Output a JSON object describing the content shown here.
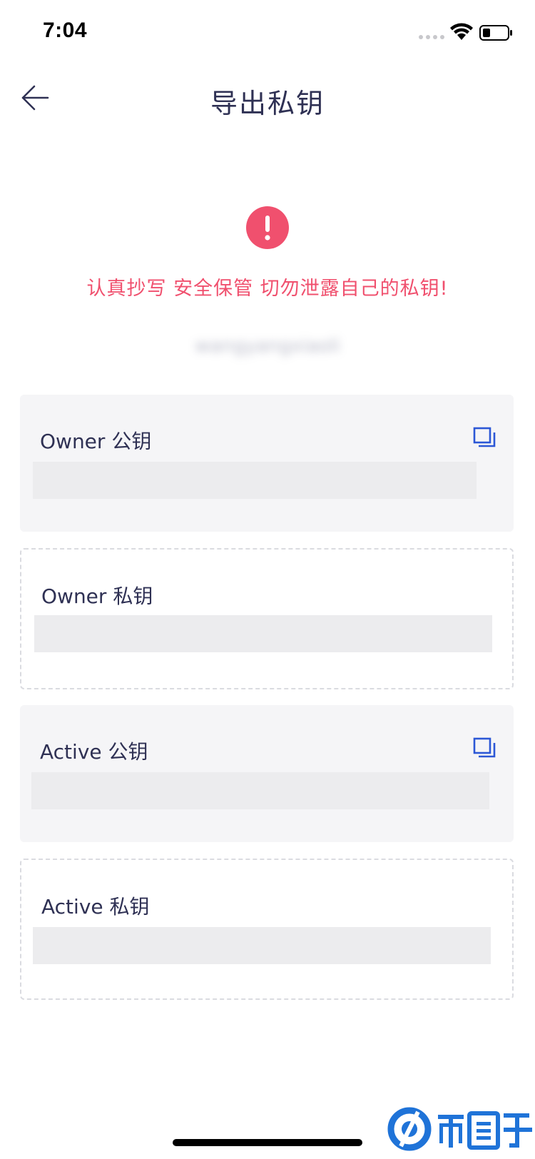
{
  "status_bar": {
    "time": "7:04"
  },
  "nav": {
    "title": "导出私钥"
  },
  "warning": {
    "text": "认真抄写 安全保管 切勿泄露自己的私钥!",
    "color": "#f0506e"
  },
  "account": {
    "name": "wangyangxiaoli"
  },
  "keys": [
    {
      "label": "Owner 公钥",
      "type": "public"
    },
    {
      "label": "Owner 私钥",
      "type": "private"
    },
    {
      "label": "Active 公钥",
      "type": "public"
    },
    {
      "label": "Active 私钥",
      "type": "private"
    }
  ],
  "colors": {
    "primary_text": "#2f3154",
    "accent_blue": "#2c57d6",
    "warning_red": "#f0506e",
    "card_bg": "#f5f5f7"
  },
  "icons": {
    "back": "arrow-left-icon",
    "warning": "exclamation-circle-icon",
    "copy": "copy-icon"
  }
}
